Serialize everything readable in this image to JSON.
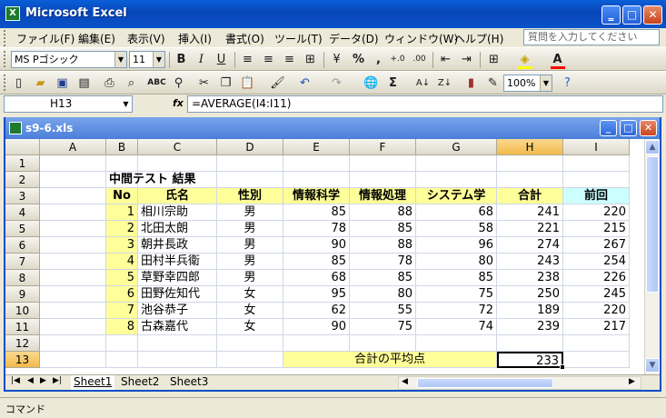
{
  "app": {
    "title": "Microsoft Excel"
  },
  "menu": {
    "items": [
      "ファイル(F)",
      "編集(E)",
      "表示(V)",
      "挿入(I)",
      "書式(O)",
      "ツール(T)",
      "データ(D)",
      "ウィンドウ(W)",
      "ヘルプ(H)"
    ],
    "help_placeholder": "質問を入力してください"
  },
  "format_toolbar": {
    "font": "MS Pゴシック",
    "size": "11",
    "bold": "B",
    "italic": "I",
    "underline": "U",
    "percent": "%",
    "comma": ",",
    "inc_decimal": "+.0",
    "dec_decimal": ".00"
  },
  "standard_toolbar": {
    "zoom": "100%",
    "sigma": "Σ"
  },
  "formula_bar": {
    "name_box": "H13",
    "fx": "fx",
    "formula": "=AVERAGE(I4:I11)"
  },
  "workbook": {
    "title": "s9-6.xls"
  },
  "columns": [
    "A",
    "B",
    "C",
    "D",
    "E",
    "F",
    "G",
    "H",
    "I"
  ],
  "rows": [
    "1",
    "2",
    "3",
    "4",
    "5",
    "6",
    "7",
    "8",
    "9",
    "10",
    "11",
    "12",
    "13"
  ],
  "sheet": {
    "title": "中間テスト 結果",
    "headers": [
      "No",
      "氏名",
      "性別",
      "情報科学",
      "情報処理",
      "システム学",
      "合計",
      "前回"
    ],
    "records": [
      [
        "1",
        "相川宗助",
        "男",
        "85",
        "88",
        "68",
        "241",
        "220"
      ],
      [
        "2",
        "北田太朗",
        "男",
        "78",
        "85",
        "58",
        "221",
        "215"
      ],
      [
        "3",
        "朝井長政",
        "男",
        "90",
        "88",
        "96",
        "274",
        "267"
      ],
      [
        "4",
        "田村半兵衛",
        "男",
        "85",
        "78",
        "80",
        "243",
        "254"
      ],
      [
        "5",
        "草野幸四郎",
        "男",
        "68",
        "85",
        "85",
        "238",
        "226"
      ],
      [
        "6",
        "田野佐知代",
        "女",
        "95",
        "80",
        "75",
        "250",
        "245"
      ],
      [
        "7",
        "池谷恭子",
        "女",
        "62",
        "55",
        "72",
        "189",
        "220"
      ],
      [
        "8",
        "古森嘉代",
        "女",
        "90",
        "75",
        "74",
        "239",
        "217"
      ]
    ],
    "avg_label": "合計の平均点",
    "avg_value": "233"
  },
  "sheet_tabs": [
    "Sheet1",
    "Sheet2",
    "Sheet3"
  ],
  "status": "コマンド",
  "colors": {
    "header_yellow": "#ffff99",
    "header_blue": "#ccffff",
    "selected_header": "#f2ba4b",
    "titlebar": "#0a53c9"
  }
}
